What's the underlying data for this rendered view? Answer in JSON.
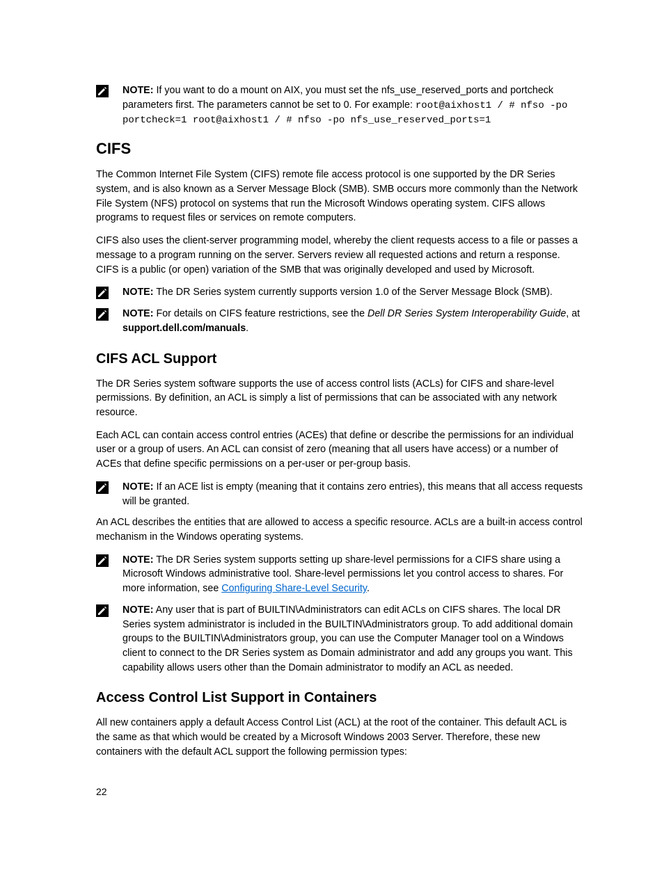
{
  "note1": {
    "label": "NOTE:",
    "t1": " If you want to do a mount on AIX, you must set the nfs_use_reserved_ports and portcheck parameters first. The parameters cannot be set to 0. For example: ",
    "code1": "root@aixhost1 / # nfso -po portcheck=1 root@aixhost1 / # nfso -po nfs_use_reserved_ports=1"
  },
  "h_cifs": "CIFS",
  "p1": "The Common Internet File System (CIFS) remote file access protocol is one supported by the DR Series system, and is also known as a Server Message Block (SMB). SMB occurs more commonly than the Network File System (NFS) protocol on systems that run the Microsoft Windows operating system. CIFS allows programs to request files or services on remote computers.",
  "p2": "CIFS also uses the client-server programming model, whereby the client requests access to a file or passes a message to a program running on the server. Servers review all requested actions and return a response. CIFS is a public (or open) variation of the SMB that was originally developed and used by Microsoft.",
  "note2": {
    "label": "NOTE:",
    "t1": " The DR Series system currently supports version 1.0 of the Server Message Block (SMB)."
  },
  "note3": {
    "label": "NOTE:",
    "t1": " For details on CIFS feature restrictions, see the ",
    "italic": "Dell DR Series System Interoperability Guide",
    "t2": ", at ",
    "bold": "support.dell.com/manuals",
    "t3": "."
  },
  "h_acl": "CIFS ACL Support",
  "p3": "The DR Series system software supports the use of access control lists (ACLs) for CIFS and share-level permissions. By definition, an ACL is simply a list of permissions that can be associated with any network resource.",
  "p4": "Each ACL can contain access control entries (ACEs) that define or describe the permissions for an individual user or a group of users. An ACL can consist of zero (meaning that all users have access) or a number of ACEs that define specific permissions on a per-user or per-group basis.",
  "note4": {
    "label": "NOTE:",
    "t1": " If an ACE list is empty (meaning that it contains zero entries), this means that all access requests will be granted."
  },
  "p5": "An ACL describes the entities that are allowed to access a specific resource. ACLs are a built-in access control mechanism in the Windows operating systems.",
  "note5": {
    "label": "NOTE:",
    "t1": " The DR Series system supports setting up share-level permissions for a CIFS share using a Microsoft Windows administrative tool. Share-level permissions let you control access to shares. For more information, see ",
    "link": "Configuring Share-Level Security",
    "t2": "."
  },
  "note6": {
    "label": "NOTE:",
    "t1": " Any user that is part of BUILTIN\\Administrators can edit ACLs on CIFS shares. The local DR Series system administrator is included in the BUILTIN\\Administrators group. To add additional domain groups to the BUILTIN\\Administrators group, you can use the Computer Manager tool on a Windows client to connect to the DR Series system as Domain administrator and add any groups you want. This capability allows users other than the Domain administrator to modify an ACL as needed."
  },
  "h_containers": "Access Control List Support in Containers",
  "p6": "All new containers apply a default Access Control List (ACL) at the root of the container. This default ACL is the same as that which would be created by a Microsoft Windows 2003 Server. Therefore, these new containers with the default ACL support the following permission types:",
  "page_number": "22"
}
